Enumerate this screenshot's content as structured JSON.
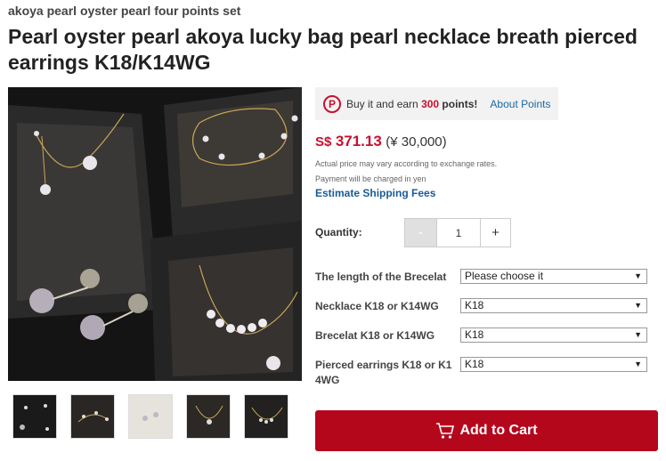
{
  "product": {
    "subtitle": "akoya pearl oyster pearl four points set",
    "title": "Pearl oyster pearl akoya lucky bag pearl necklace breath pierced earrings K18/K14WG"
  },
  "points": {
    "icon": "points-p-icon",
    "text_before": "Buy it and earn ",
    "amount": "300",
    "text_after": " points!",
    "about_link": "About Points"
  },
  "price": {
    "currency": "S$",
    "amount": "371.13",
    "yen": "(¥ 30,000)",
    "note_exchange": "Actual price may vary according to exchange rates.",
    "note_yen": "Payment will be charged in yen",
    "shipping_link": "Estimate Shipping Fees"
  },
  "quantity": {
    "label": "Quantity:",
    "minus": "-",
    "value": "1",
    "plus": "+"
  },
  "options": [
    {
      "label": "The length of the Brecelat",
      "selected": "Please choose it"
    },
    {
      "label": "Necklace K18 or K14WG",
      "selected": "K18"
    },
    {
      "label": "Brecelat K18 or K14WG",
      "selected": "K18"
    },
    {
      "label": "Pierced earrings K18 or K14WG",
      "selected": "K18"
    }
  ],
  "cart": {
    "label": "Add to Cart",
    "icon": "cart-icon"
  },
  "colors": {
    "accent_red": "#b5071c",
    "price_red": "#c8102e",
    "link_blue": "#1a6aa8"
  }
}
